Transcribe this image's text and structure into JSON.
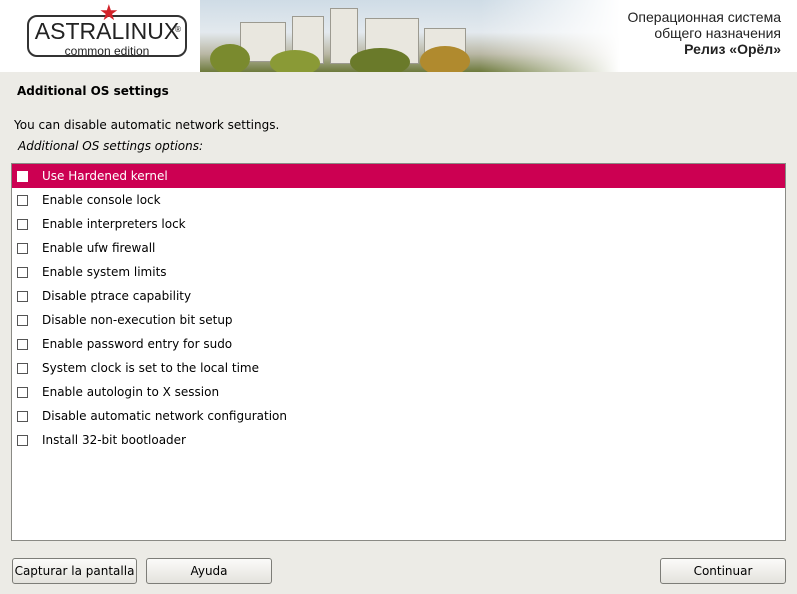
{
  "header": {
    "logo_main": "ASTRALINUX",
    "logo_sub": "common edition",
    "logo_reg": "®",
    "line1": "Операционная система",
    "line2": "общего назначения",
    "release": "Релиз «Орёл»",
    "accent_color": "#d2232a"
  },
  "page": {
    "title": "Additional OS settings",
    "description": "You can disable automatic network settings.",
    "list_caption": "Additional OS settings options:"
  },
  "options": [
    {
      "label": "Use Hardened kernel",
      "checked": false,
      "selected": true
    },
    {
      "label": "Enable console lock",
      "checked": false
    },
    {
      "label": "Enable interpreters lock",
      "checked": false
    },
    {
      "label": "Enable ufw firewall",
      "checked": false
    },
    {
      "label": "Enable system limits",
      "checked": false
    },
    {
      "label": "Disable ptrace capability",
      "checked": false
    },
    {
      "label": "Disable non-execution bit setup",
      "checked": false
    },
    {
      "label": "Enable password entry for sudo",
      "checked": false
    },
    {
      "label": "System clock is set to the local time",
      "checked": false
    },
    {
      "label": "Enable autologin to X session",
      "checked": false
    },
    {
      "label": "Disable automatic network configuration",
      "checked": false
    },
    {
      "label": "Install 32-bit bootloader",
      "checked": false
    }
  ],
  "buttons": {
    "screenshot": "Capturar la pantalla",
    "help": "Ayuda",
    "continue": "Continuar"
  },
  "colors": {
    "selection": "#cc0052",
    "background": "#ecebe6"
  }
}
